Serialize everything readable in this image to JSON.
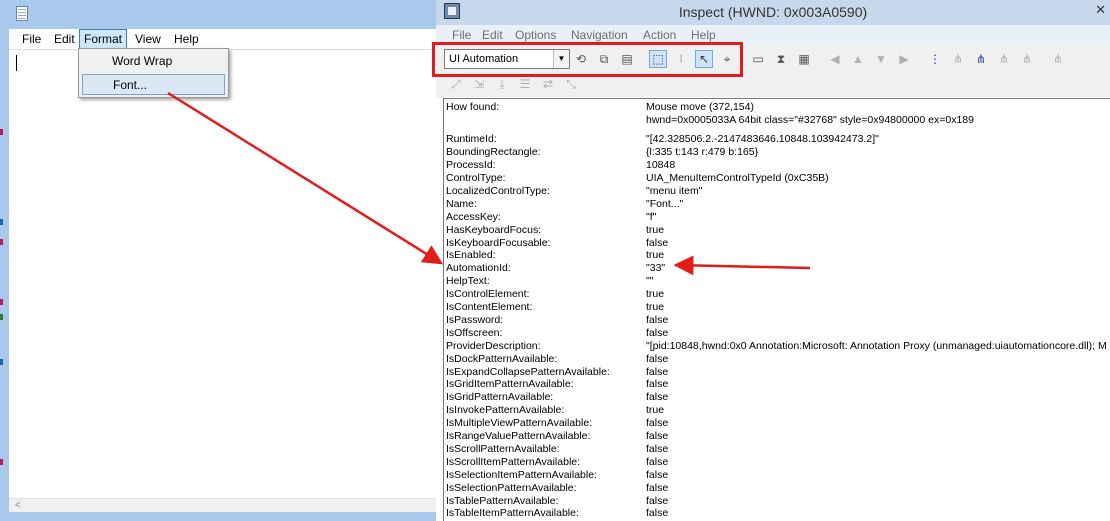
{
  "notepad": {
    "menu": [
      "File",
      "Edit",
      "Format",
      "View",
      "Help"
    ],
    "format_menu": {
      "items": [
        "Word Wrap",
        "Font..."
      ]
    }
  },
  "inspect": {
    "title": "Inspect  (HWND: 0x003A0590)",
    "close": "✕",
    "menu": [
      "File",
      "Edit",
      "Options",
      "Navigation",
      "Action",
      "Help"
    ],
    "mode_select": "UI Automation",
    "properties": [
      {
        "name": "How found:",
        "value": "Mouse move (372,154)"
      },
      {
        "name": "",
        "value": "hwnd=0x0005033A 64bit class=\"#32768\" style=0x94800000 ex=0x189"
      },
      {
        "name": "RuntimeId:",
        "value": "\"[42.328506.2.-2147483646.10848.103942473.2]\""
      },
      {
        "name": "BoundingRectangle:",
        "value": "{l:335 t:143 r:479 b:165}"
      },
      {
        "name": "ProcessId:",
        "value": "10848"
      },
      {
        "name": "ControlType:",
        "value": "UIA_MenuItemControlTypeId (0xC35B)"
      },
      {
        "name": "LocalizedControlType:",
        "value": "\"menu item\""
      },
      {
        "name": "Name:",
        "value": "\"Font...\""
      },
      {
        "name": "AccessKey:",
        "value": "\"f\""
      },
      {
        "name": "HasKeyboardFocus:",
        "value": "true"
      },
      {
        "name": "IsKeyboardFocusable:",
        "value": "false"
      },
      {
        "name": "IsEnabled:",
        "value": "true"
      },
      {
        "name": "AutomationId:",
        "value": "\"33\""
      },
      {
        "name": "HelpText:",
        "value": "\"\""
      },
      {
        "name": "IsControlElement:",
        "value": "true"
      },
      {
        "name": "IsContentElement:",
        "value": "true"
      },
      {
        "name": "IsPassword:",
        "value": "false"
      },
      {
        "name": "IsOffscreen:",
        "value": "false"
      },
      {
        "name": "ProviderDescription:",
        "value": "\"[pid:10848,hwnd:0x0 Annotation:Microsoft: Annotation Proxy (unmanaged:uiautomationcore.dll); M"
      },
      {
        "name": "IsDockPatternAvailable:",
        "value": "false"
      },
      {
        "name": "IsExpandCollapsePatternAvailable:",
        "value": "false"
      },
      {
        "name": "IsGridItemPatternAvailable:",
        "value": "false"
      },
      {
        "name": "IsGridPatternAvailable:",
        "value": "false"
      },
      {
        "name": "IsInvokePatternAvailable:",
        "value": "true"
      },
      {
        "name": "IsMultipleViewPatternAvailable:",
        "value": "false"
      },
      {
        "name": "IsRangeValuePatternAvailable:",
        "value": "false"
      },
      {
        "name": "IsScrollPatternAvailable:",
        "value": "false"
      },
      {
        "name": "IsScrollItemPatternAvailable:",
        "value": "false"
      },
      {
        "name": "IsSelectionItemPatternAvailable:",
        "value": "false"
      },
      {
        "name": "IsSelectionPatternAvailable:",
        "value": "false"
      },
      {
        "name": "IsTablePatternAvailable:",
        "value": "false"
      },
      {
        "name": "IsTableItemPatternAvailable:",
        "value": "false"
      }
    ]
  },
  "annotation_color": "#e41b1b"
}
